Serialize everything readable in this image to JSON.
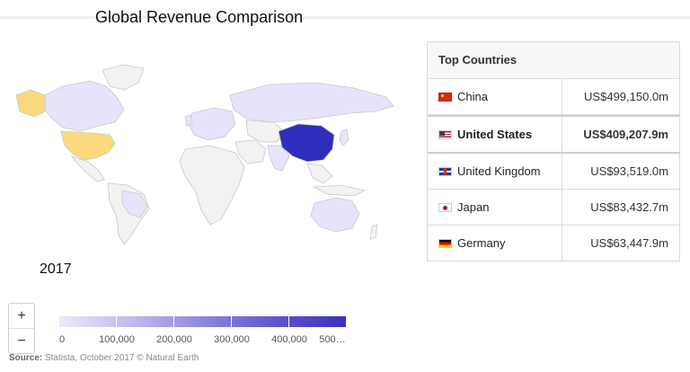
{
  "title": "Global Revenue Comparison",
  "year": "2017",
  "table": {
    "header": "Top Countries",
    "rows": [
      {
        "country": "China",
        "value": "US$499,150.0m",
        "flag": "china-flag-icon",
        "highlight": false
      },
      {
        "country": "United States",
        "value": "US$409,207.9m",
        "flag": "usa-flag-icon",
        "highlight": true
      },
      {
        "country": "United Kingdom",
        "value": "US$93,519.0m",
        "flag": "uk-flag-icon",
        "highlight": false
      },
      {
        "country": "Japan",
        "value": "US$83,432.7m",
        "flag": "japan-flag-icon",
        "highlight": false
      },
      {
        "country": "Germany",
        "value": "US$63,447.9m",
        "flag": "germany-flag-icon",
        "highlight": false
      }
    ]
  },
  "zoom": {
    "in_label": "+",
    "out_label": "−"
  },
  "legend": {
    "labels": [
      "0",
      "100,000",
      "200,000",
      "300,000",
      "400,000",
      "500…"
    ],
    "colors": [
      "#ebe9fb",
      "#c8c4f0",
      "#a39ce3",
      "#7d73d6",
      "#5a4ecb",
      "#3a31bd"
    ]
  },
  "map_colors": {
    "no_data": "#f2f2f2",
    "low": "#e6e4fa",
    "highlight": "#fcd97d",
    "china": "#2f2dbb",
    "border": "#c8c8c8"
  },
  "source": {
    "label": "Source:",
    "text": "Statista, October 2017 © Natural Earth"
  }
}
